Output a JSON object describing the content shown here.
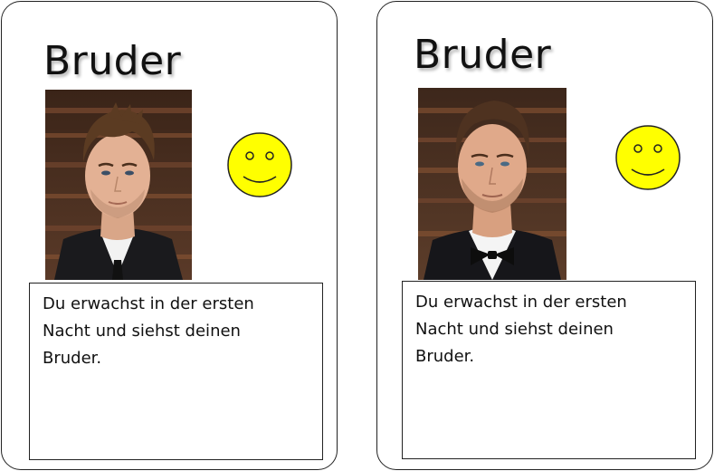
{
  "cards": [
    {
      "title": "Bruder",
      "text": "Du erwachst in der ersten Nacht und siehst deinen Bruder.",
      "photo_icon": "portrait-photo-young-man",
      "mood_icon": "smiley-face-icon"
    },
    {
      "title": "Bruder",
      "text": "Du erwachst in der ersten Nacht und siehst deinen Bruder.",
      "photo_icon": "portrait-photo-man-bowtie",
      "mood_icon": "smiley-face-icon"
    }
  ],
  "colors": {
    "smiley_fill": "#ffff00",
    "outline": "#222222",
    "text": "#111111"
  }
}
